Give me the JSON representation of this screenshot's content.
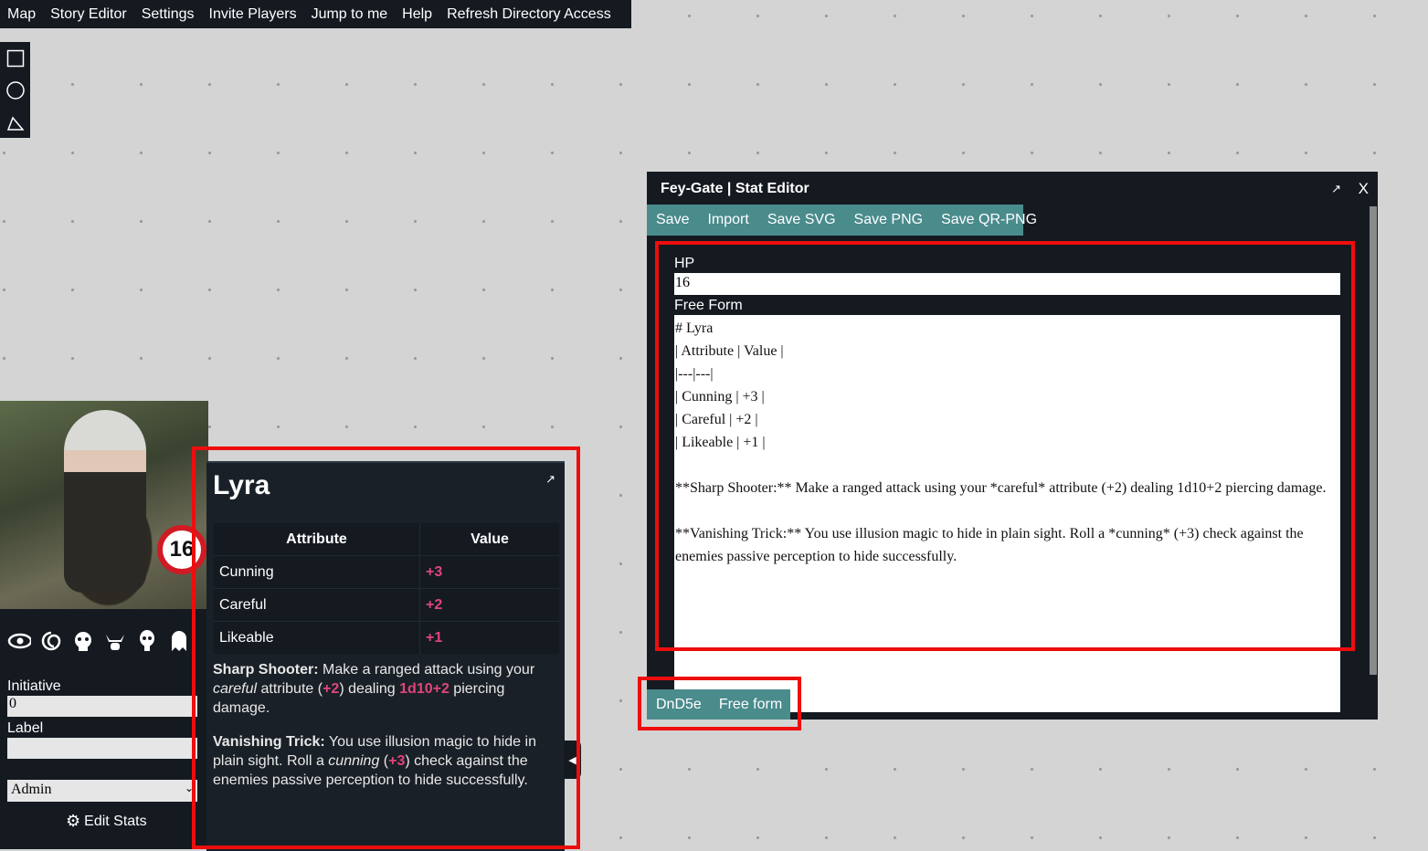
{
  "menu": [
    "Map",
    "Story Editor",
    "Settings",
    "Invite Players",
    "Jump to me",
    "Help",
    "Refresh Directory Access"
  ],
  "tools": [
    "square-tool",
    "circle-tool",
    "pen-tool"
  ],
  "token": {
    "hp": "16",
    "icons": [
      "eye-icon",
      "swirl-icon",
      "monster-icon",
      "viking-icon",
      "skull-icon",
      "ghost-icon"
    ],
    "initiative_label": "Initiative",
    "initiative_value": "0",
    "label_label": "Label",
    "label_value": "",
    "owner_value": "Admin",
    "edit_stats": "Edit Stats"
  },
  "popup": {
    "name": "Lyra",
    "expand": "↗",
    "table": {
      "headers": [
        "Attribute",
        "Value"
      ],
      "rows": [
        [
          "Cunning",
          "+3"
        ],
        [
          "Careful",
          "+2"
        ],
        [
          "Likeable",
          "+1"
        ]
      ]
    },
    "ability1": {
      "name": "Sharp Shooter:",
      "t1": " Make a ranged attack using your ",
      "em": "careful",
      "t2": " attribute (",
      "v": "+2",
      "t3": ") dealing ",
      "dmg": "1d10+2",
      "t4": " piercing damage."
    },
    "ability2": {
      "name": "Vanishing Trick:",
      "t1": " You use illusion magic to hide in plain sight. Roll a ",
      "em": "cunning",
      "t2": " (",
      "v": "+3",
      "t3": ") check against the enemies passive perception to hide successfully."
    }
  },
  "editor": {
    "title": "Fey-Gate | Stat Editor",
    "popout": "↗",
    "close": "X",
    "toolbar": [
      "Save",
      "Import",
      "Save SVG",
      "Save PNG",
      "Save QR-PNG"
    ],
    "hp_label": "HP",
    "hp_value": "16",
    "freeform_label": "Free Form",
    "freeform_lines": [
      "# Lyra",
      "| Attribute | Value |",
      "|---|---|",
      "| Cunning | +3 |",
      "| Careful | +2 |",
      "| Likeable | +1 |",
      "",
      "**Sharp Shooter:** Make a ranged attack using your *careful* attribute (+2) dealing 1d10+2 piercing damage.",
      "",
      "**Vanishing Trick:** You use illusion magic to hide in plain sight. Roll a *cunning* (+3) check against the enemies passive perception to hide successfully."
    ],
    "modes": [
      "DnD5e",
      "Free form"
    ]
  },
  "colors": {
    "accent": "#4a8b8c",
    "highlight": "#ee0d0d",
    "value_pink": "#e0457b",
    "panel": "#141a20"
  }
}
